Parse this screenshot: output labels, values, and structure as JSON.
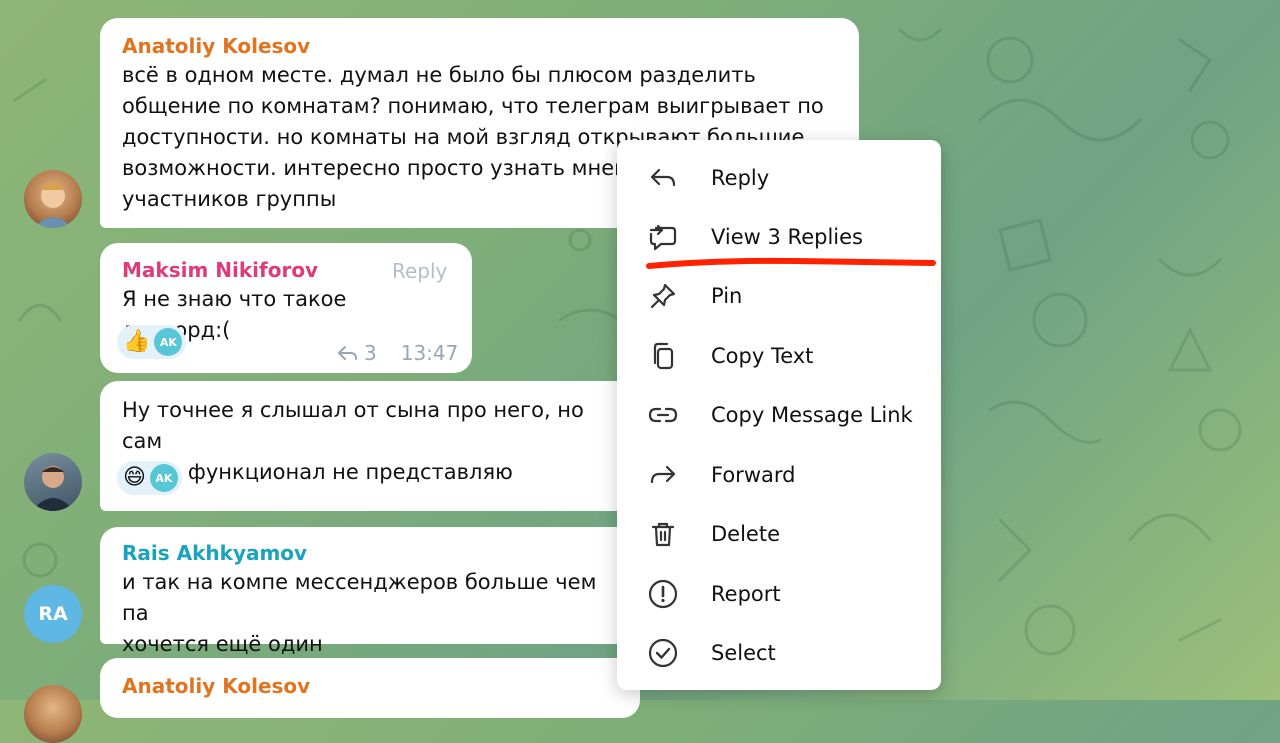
{
  "colors": {
    "sender_orange": "#e1741f",
    "sender_pink": "#de3b7a",
    "sender_teal": "#1aa3bc",
    "annotation_red": "#ff2200",
    "avatar_ra": "#5fb7e3"
  },
  "messages": [
    {
      "sender": "Anatoliy Kolesov",
      "text": "всё в одном месте. думал не было бы плюсом разделить\nобщение по комнатам? понимаю, что телеграм выигрывает по\nдоступности. но комнаты на мой взгляд открывают большие\nвозможности. интересно просто узнать мнение\nучастников группы"
    },
    {
      "sender": "Maksim Nikiforov",
      "reply_label": "Reply",
      "text": "Я не знаю что такое дискорд:(",
      "reaction_emoji": "👍",
      "reaction_user": "AK",
      "reply_count": "3",
      "time": "13:47"
    },
    {
      "text": "Ну точнее я слышал от сына про него, но сам\nдаже функционал не представляю",
      "reaction_emoji": "😄",
      "reaction_user": "AK"
    },
    {
      "sender": "Rais Akhkyamov",
      "avatar_initials": "RA",
      "text": "и так на компе мессенджеров больше чем па\nхочется ещё один"
    },
    {
      "sender": "Anatoliy Kolesov"
    }
  ],
  "context_menu": {
    "items": [
      {
        "label": "Reply",
        "icon": "reply-icon"
      },
      {
        "label": "View 3 Replies",
        "icon": "view-replies-icon"
      },
      {
        "label": "Pin",
        "icon": "pin-icon"
      },
      {
        "label": "Copy Text",
        "icon": "copy-icon"
      },
      {
        "label": "Copy Message Link",
        "icon": "link-icon"
      },
      {
        "label": "Forward",
        "icon": "forward-icon"
      },
      {
        "label": "Delete",
        "icon": "trash-icon"
      },
      {
        "label": "Report",
        "icon": "report-icon"
      },
      {
        "label": "Select",
        "icon": "select-check-icon"
      }
    ]
  }
}
